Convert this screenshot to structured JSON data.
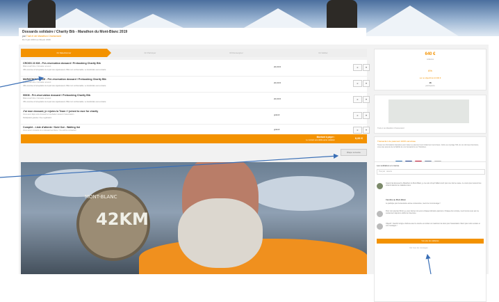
{
  "header": {
    "title": "Dossards solidaire / Charity Bib - Marathon du Mont-Blanc 2019",
    "subtitle_prefix": "par",
    "organizer": "Trail et vie Marathon Chamoniard",
    "date": "Du 3 juin 2019 au 30 juin 2019"
  },
  "tabs": [
    {
      "label": "01 Sélectionner"
    },
    {
      "label": "02 Participer"
    },
    {
      "label": "03 Renseigner"
    },
    {
      "label": "04 Valider"
    }
  ],
  "tickets": [
    {
      "name": "CROSS 23 KM - Pré-réservation dossard / Prebooking Charity Bib",
      "sub": "Billet à tarif libre / Donation amount",
      "desc": "Offre soumise à l'acceptation de la part des organisateurs. Billet non remboursable. Le bénéficiaire sera contacté.",
      "price": "20,00 €",
      "qty": "0"
    },
    {
      "name": "MARATHON 42 KM - Pré-réservation dossard / Prebooking Charity Bib",
      "sub": "Billet à tarif libre / Donation amount",
      "desc": "Offre soumise à l'acceptation de la part des organisateurs. Billet non remboursable. Le bénéficiaire sera contacté.",
      "price": "20,00 €",
      "qty": "0"
    },
    {
      "name": "90KM - Pré-réservation dossard / Prebooking Charity Bib",
      "sub": "Billet à tarif libre / Donation amount",
      "desc": "Offre soumise à l'acceptation de la part des organisateurs. Billet non remboursable. Le bénéficiaire sera contacté.",
      "price": "20,00 €",
      "qty": "0"
    },
    {
      "name": "J'ai mon dossard, je rejoins la Team / I joined to race for charity",
      "sub": "Vous avez déjà votre dossard et souhaitez soutenir l'association",
      "desc": "Participation gratuite / Free registration",
      "price": "gratuit",
      "qty": "0"
    },
    {
      "name": "Complet - Liste d'attente / Sold Out - Waiting list",
      "sub": "Vous serez contacté si un dossard se libère / You will be contacted",
      "desc": "",
      "price": "gratuit",
      "qty": "0"
    }
  ],
  "total": {
    "label": "Montant à payer :",
    "note": "Le montant sera débité après validation",
    "value": "0,00 €"
  },
  "next_button": "Étape suivante",
  "sidebar": {
    "amount": "640 €",
    "amount_caption": "collectés",
    "percent": "6%",
    "goal_caption": "sur un objectif de 10 000 €",
    "participants": "16",
    "participants_caption": "participants",
    "map_caption": "Trail et vie Marathon Chamoniard",
    "secure_title": "Transaction de paiement 100% sécurisée",
    "secure_text": "Toutes les informations bancaires pour traiter ce paiement sont totalement sécurisées. Grâce au cryptage SSL de vos données bancaires, vous êtes assurés de la fiabilité de vos transactions sur HelloAsso.",
    "pay_icons": [
      "cb-icon",
      "visa-icon",
      "mastercard-icon",
      "amex-icon",
      "sepa-icon"
    ],
    "feed_title": "Les solidaires en course",
    "feed_select": "Trier par : récents",
    "feed": [
      {
        "name": "",
        "text": "Quand j'ai découvert le Marathon du Mont-Blanc, je me suis dit qu'il fallait courir pour une bonne cause. Je cours pour soutenir les enfants atteints de maladies rares."
      },
      {
        "name": "Caroline au Mont-Blanc",
        "text": "Je participe pour la deuxième année consécutive, merci de m'encourager !"
      },
      {
        "name": "",
        "text": "Pour mon premier 90 km, je veux donner du sens à chaque kilomètre parcouru. Chaque don compte, merci à tous ceux qui me soutiennent depuis le début de l'aventure."
      },
      {
        "name": "",
        "text": "Objectif : franchir la ligne d'arrivée avec le sourire et récolter un maximum de dons pour l'association. Merci pour votre soutien et vos messages !"
      }
    ],
    "more_button": "Voir plus de solidaires",
    "feed_footer": "Voir tous les messages"
  },
  "photo": {
    "medal_text": "42KM",
    "medal_ring": "MONT-BLANC"
  },
  "colors": {
    "accent": "#f39200"
  }
}
